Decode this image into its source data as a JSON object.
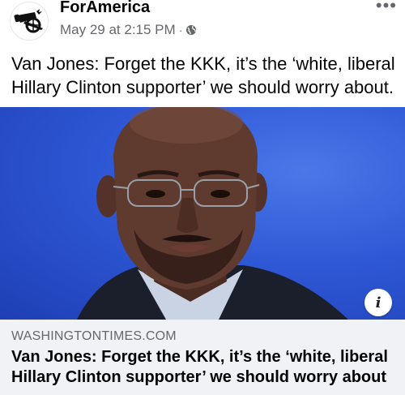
{
  "post": {
    "page_name": "ForAmerica",
    "timestamp": "May 29 at 2:15 PM",
    "separator": "·",
    "privacy_icon": "globe-icon",
    "more_label": "•••",
    "caption": "Van Jones: Forget the KKK, it’s the ‘white, liberal Hillary Clinton supporter’ we should worry about."
  },
  "link_preview": {
    "domain": "WASHINGTONTIMES.COM",
    "title": "Van Jones: Forget the KKK, it’s the ‘white, liberal Hillary Clinton supporter’ we should worry about",
    "info_label": "i"
  },
  "colors": {
    "image_background": "#2f58d6",
    "link_box_background": "#f0f2f5",
    "meta_text": "#65676b"
  }
}
